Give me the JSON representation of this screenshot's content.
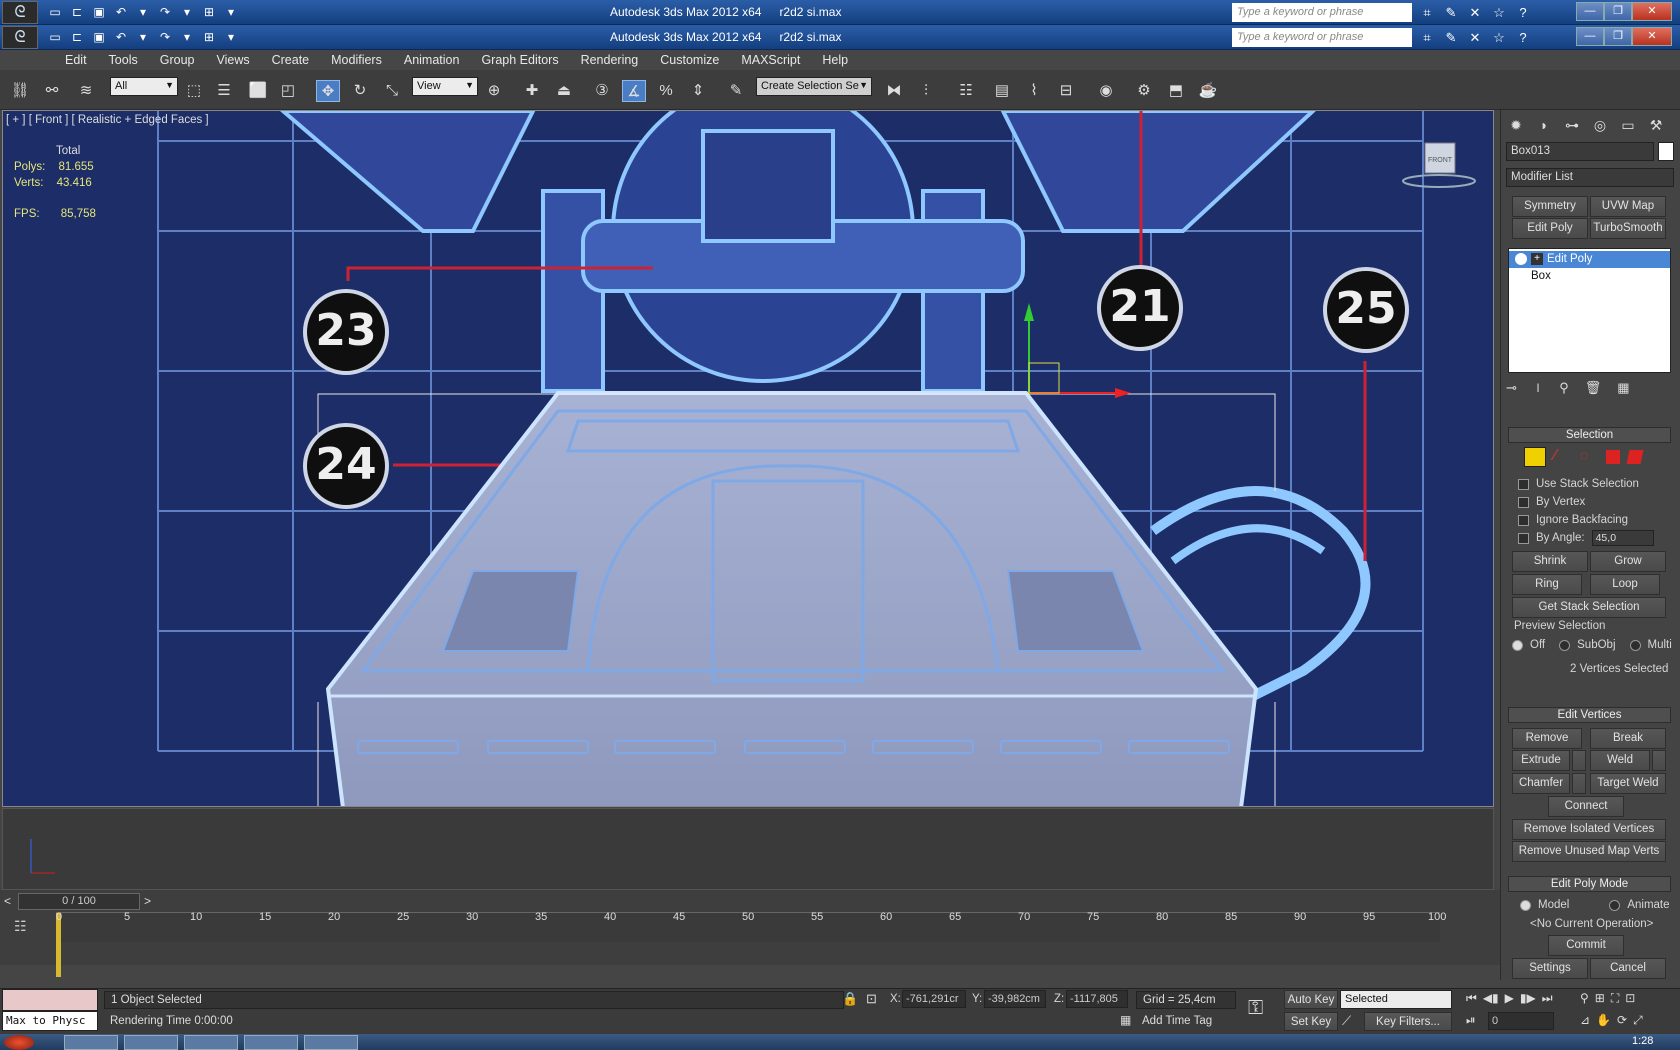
{
  "window": {
    "app_title": "Autodesk 3ds Max  2012 x64",
    "file_name": "r2d2 si.max",
    "search_placeholder": "Type a keyword or phrase"
  },
  "menu": [
    "Edit",
    "Tools",
    "Group",
    "Views",
    "Create",
    "Modifiers",
    "Animation",
    "Graph Editors",
    "Rendering",
    "Customize",
    "MAXScript",
    "Help"
  ],
  "toolbar": {
    "filter": "All",
    "ref_coord": "View",
    "selection_set": "Create Selection Se"
  },
  "viewport": {
    "label": "[ + ] [ Front ] [ Realistic + Edged Faces ]",
    "stats_header": "Total",
    "polys_label": "Polys:",
    "polys_value": "81.655",
    "verts_label": "Verts:",
    "verts_value": "43.416",
    "fps_label": "FPS:",
    "fps_value": "85,758",
    "viewcube_label": "FRONT",
    "badges": [
      "23",
      "24",
      "21",
      "25"
    ],
    "colors": {
      "background": "#1c2d67",
      "blueprint_line": "#8ec8ff",
      "mesh": "#9aa6c8"
    }
  },
  "command_panel": {
    "object_name": "Box013",
    "modifier_list": "Modifier List",
    "buttons": [
      "Symmetry",
      "UVW Map",
      "Edit Poly",
      "TurboSmooth"
    ],
    "stack": [
      "Edit Poly",
      "Box"
    ],
    "selection": {
      "title": "Selection",
      "use_stack_selection": "Use Stack Selection",
      "by_vertex": "By Vertex",
      "ignore_backfacing": "Ignore Backfacing",
      "by_angle": "By Angle:",
      "angle_value": "45,0",
      "shrink": "Shrink",
      "grow": "Grow",
      "ring": "Ring",
      "loop": "Loop",
      "get_stack_selection": "Get Stack Selection",
      "preview_selection": "Preview Selection",
      "preview_off": "Off",
      "preview_subobj": "SubObj",
      "preview_multi": "Multi",
      "status": "2 Vertices Selected"
    },
    "edit_vertices": {
      "title": "Edit Vertices",
      "remove": "Remove",
      "break": "Break",
      "extrude": "Extrude",
      "weld": "Weld",
      "chamfer": "Chamfer",
      "target_weld": "Target Weld",
      "connect": "Connect",
      "remove_isolated": "Remove Isolated Vertices",
      "remove_unused": "Remove Unused Map Verts"
    },
    "edit_poly_mode": {
      "title": "Edit Poly Mode",
      "model": "Model",
      "animate": "Animate",
      "current_op": "<No Current Operation>",
      "commit": "Commit",
      "settings": "Settings",
      "cancel": "Cancel"
    }
  },
  "timeline": {
    "frame_display": "0 / 100",
    "prev": "<",
    "next": ">",
    "ticks": [
      "0",
      "5",
      "10",
      "15",
      "20",
      "25",
      "30",
      "35",
      "40",
      "45",
      "50",
      "55",
      "60",
      "65",
      "70",
      "75",
      "80",
      "85",
      "90",
      "95",
      "100"
    ]
  },
  "status": {
    "maxscript": "Max to Physc",
    "objects_selected": "1 Object Selected",
    "rendering_time": "Rendering Time  0:00:00",
    "x_label": "X:",
    "x_value": "-761,291cr",
    "y_label": "Y:",
    "y_value": "-39,982cm",
    "z_label": "Z:",
    "z_value": "-1117,805",
    "grid": "Grid = 25,4cm",
    "add_time_tag": "Add Time Tag",
    "auto_key": "Auto Key",
    "set_key": "Set Key",
    "key_mode": "Selected",
    "key_filters": "Key Filters...",
    "frame_value": "0",
    "clock": "1:28"
  }
}
